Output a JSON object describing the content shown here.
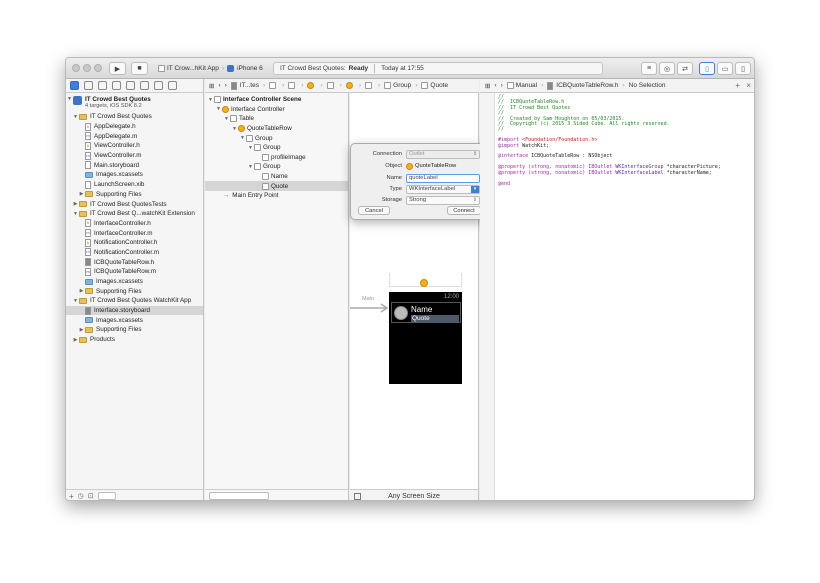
{
  "toolbar": {
    "scheme_name": "IT Crow...hKit App",
    "device": "iPhone 6",
    "status_project": "IT Crowd Best Quotes:",
    "status_state": "Ready",
    "status_time": "Today at 17:55"
  },
  "storyboard_jumpbar": {
    "items": [
      "IT...tes",
      "Group",
      "Quote"
    ]
  },
  "editor_jumpbar": {
    "mode": "Manual",
    "file": "ICBQuoteTableRow.h",
    "selection": "No Selection"
  },
  "navigator": {
    "project": {
      "name": "IT Crowd Best Quotes",
      "subtitle": "4 targets, iOS SDK 8.2"
    },
    "items": [
      {
        "label": "IT Crowd Best Quotes",
        "kind": "folder"
      },
      {
        "label": "AppDelegate.h",
        "kind": "h"
      },
      {
        "label": "AppDelegate.m",
        "kind": "m"
      },
      {
        "label": "ViewController.h",
        "kind": "h"
      },
      {
        "label": "ViewController.m",
        "kind": "m"
      },
      {
        "label": "Main.storyboard",
        "kind": "sb"
      },
      {
        "label": "Images.xcassets",
        "kind": "assets"
      },
      {
        "label": "LaunchScreen.xib",
        "kind": "xib"
      },
      {
        "label": "Supporting Files",
        "kind": "folder"
      },
      {
        "label": "IT Crowd Best QuotesTests",
        "kind": "folder"
      },
      {
        "label": "IT Crowd Best Q...watchKit Extension",
        "kind": "folder"
      },
      {
        "label": "InterfaceController.h",
        "kind": "h"
      },
      {
        "label": "InterfaceController.m",
        "kind": "m"
      },
      {
        "label": "NotificationController.h",
        "kind": "h"
      },
      {
        "label": "NotificationController.m",
        "kind": "m"
      },
      {
        "label": "ICBQuoteTableRow.h",
        "kind": "h"
      },
      {
        "label": "ICBQuoteTableRow.m",
        "kind": "m"
      },
      {
        "label": "Images.xcassets",
        "kind": "assets"
      },
      {
        "label": "Supporting Files",
        "kind": "folder"
      },
      {
        "label": "IT Crowd Best Quotes WatchKit App",
        "kind": "folder"
      },
      {
        "label": "Interface.storyboard",
        "kind": "sb"
      },
      {
        "label": "Images.xcassets",
        "kind": "assets"
      },
      {
        "label": "Supporting Files",
        "kind": "folder"
      },
      {
        "label": "Products",
        "kind": "folder"
      }
    ]
  },
  "outline": {
    "items": [
      {
        "label": "Interface Controller Scene"
      },
      {
        "label": "Interface Controller"
      },
      {
        "label": "Table"
      },
      {
        "label": "QuoteTableRow"
      },
      {
        "label": "Group"
      },
      {
        "label": "Group"
      },
      {
        "label": "profileImage"
      },
      {
        "label": "Group"
      },
      {
        "label": "Name"
      },
      {
        "label": "Quote"
      },
      {
        "label": "Main Entry Point"
      }
    ]
  },
  "canvas": {
    "entry_label": "Main",
    "watch_time": "12:00",
    "watch_name": "Name",
    "watch_quote": "Quote",
    "footer": "Any Screen Size"
  },
  "popover": {
    "connection_label": "Connection",
    "connection_value": "Outlet",
    "object_label": "Object",
    "object_value": "QuoteTableRow",
    "name_label": "Name",
    "name_value": "quoteLabel",
    "type_label": "Type",
    "type_value": "WKInterfaceLabel",
    "storage_label": "Storage",
    "storage_value": "Strong",
    "cancel": "Cancel",
    "connect": "Connect"
  },
  "code": {
    "l1": "//",
    "l2": "//  ICBQuoteTableRow.h",
    "l3": "//  IT Crowd Best Quotes",
    "l4": "//",
    "l5": "//  Created by Sam Houghton on 05/03/2015.",
    "l6": "//  Copyright (c) 2015 3 Sided Cube. All rights reserved.",
    "l7": "//",
    "import1_kw": "#import",
    "import1_str": "<Foundation/Foundation.h>",
    "import2_kw": "@import",
    "import2_rest": "WatchKit;",
    "iface_kw": "@interface",
    "iface_rest": "ICBQuoteTableRow : NSObject",
    "prop1_kw": "@property (strong, nonatomic) IBOutlet",
    "prop1_type": "WKInterfaceGroup",
    "prop1_rest": "*characterPicture;",
    "prop2_kw": "@property (strong, nonatomic) IBOutlet",
    "prop2_type": "WKInterfaceLabel",
    "prop2_rest": "*characterName;",
    "end_kw": "@end"
  }
}
